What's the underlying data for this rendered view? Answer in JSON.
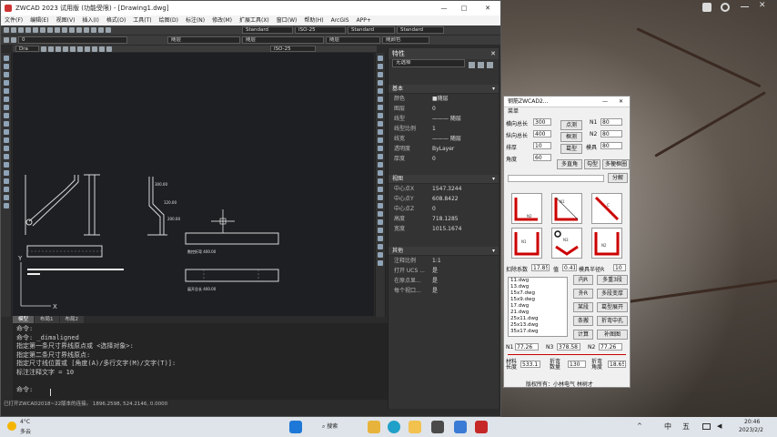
{
  "app": {
    "title": "ZWCAD 2023 试用版 (功能受限) - [Drawing1.dwg]"
  },
  "menu": [
    "文件(F)",
    "编辑(E)",
    "视图(V)",
    "插入(I)",
    "格式(O)",
    "工具(T)",
    "绘图(D)",
    "标注(N)",
    "修改(M)",
    "扩展工具(X)",
    "窗口(W)",
    "帮助(H)",
    "ArcGIS",
    "APP+"
  ],
  "toolbar": {
    "style1": "Standard",
    "dim": "ISO-25",
    "style2": "Standard",
    "style3": "Standard",
    "layer": "0",
    "color_bylayer": "随层",
    "linetype": "随层",
    "lineweight": "随层",
    "linecolor": "随颜色",
    "draw_tab": "Dra",
    "iso_small": "ISO-25"
  },
  "drawing": {
    "label_a": "数控折弯 400.00",
    "label_b": "展开总长 400.00",
    "d1": "300.00",
    "d2": "120.00",
    "d3": "200.00",
    "axis_y": "Y",
    "axis_x": "X"
  },
  "layout_tabs": [
    "模型",
    "布局1",
    "布局2"
  ],
  "command_lines": [
    "命令:",
    "命令: _dimaligned",
    "指定第一条尺寸界线原点或 <选择对象>:",
    "指定第二条尺寸界线原点:",
    "指定尺寸线位置或 [角度(A)/多行文字(M)/文字(T)]:",
    "标注注释文字 = 10",
    "",
    "命令:"
  ],
  "status_text": "已打开ZWCAD2018~22版本的连接。 1896.2598, 524.2146, 0.0000",
  "properties": {
    "title": "特性",
    "selection": "无选择",
    "basic": {
      "header": "基本",
      "rows": [
        [
          "颜色",
          "■随层"
        ],
        [
          "图层",
          "0"
        ],
        [
          "线型",
          "——— 随层"
        ],
        [
          "线型比例",
          "1"
        ],
        [
          "线宽",
          "——— 随层"
        ],
        [
          "透明度",
          "ByLayer"
        ],
        [
          "厚度",
          "0"
        ]
      ]
    },
    "view": {
      "header": "视图",
      "rows": [
        [
          "中心点X",
          "1547.3244"
        ],
        [
          "中心点Y",
          "608.8422"
        ],
        [
          "中心点Z",
          "0"
        ],
        [
          "高度",
          "718.1285"
        ],
        [
          "宽度",
          "1015.1674"
        ]
      ]
    },
    "misc": {
      "header": "其他",
      "rows": [
        [
          "注释比例",
          "1:1"
        ],
        [
          "打开 UCS ...",
          "是"
        ],
        [
          "在原点显...",
          "是"
        ],
        [
          "每个视口...",
          "是"
        ]
      ]
    }
  },
  "dialog": {
    "title": "钢筋ZWCAD2...",
    "menu": "菜单",
    "f1_label": "横向总长",
    "f1": "300",
    "f2_label": "纵向总长",
    "f2": "400",
    "f3_label": "排厚",
    "f3": "10",
    "f4_label": "角度",
    "f4": "60",
    "n1_label": "N1",
    "n1": "80",
    "n2_label": "N2",
    "n2": "80",
    "mold_label": "模具",
    "mold": "80",
    "btn_pointcalc": "点测",
    "btn_rebar": "框测",
    "btn_shape": "葛型",
    "btn_multi": "多直角",
    "btn_hook": "勾型",
    "btn_multihook": "多梗框圈",
    "btn_split": "分解",
    "coef_label": "扣除系数",
    "coef": "17.85",
    "val_label": "值",
    "val": "0.41",
    "radius_label": "模具半径R",
    "radius": "10",
    "files": [
      "11.dwg",
      "13.dwg",
      "15x7.dwg",
      "15x9.dwg",
      "17.dwg",
      "21.dwg",
      "25x11.dwg",
      "25x13.dwg",
      "35x17.dwg"
    ],
    "btn_inner": "内R",
    "btn_multi_pts": "多重3段",
    "btn_outer": "外R",
    "btn_multi_change": "多段变厚",
    "btn_stack": "某段",
    "btn_shape2": "葛型展开",
    "btn_bend": "条搬",
    "btn_flange": "折弯中孔",
    "btn_calc": "计算",
    "btn_fill": "补图图",
    "n1b_label": "N1",
    "n1b": "77.26",
    "n3_label": "N3",
    "n3": "378.58",
    "n2b_label": "N2",
    "n2b": "77.26",
    "len_label": "材料长度",
    "len": "533.1",
    "dist_label": "折弯数量",
    "dist": "130",
    "angle2_label": "折弯角度",
    "angle2": "18.65",
    "footer": "版权所有：小林电气 林树才"
  },
  "taskbar": {
    "weather_temp": "4°C",
    "weather_desc": "多云",
    "search": "搜索",
    "ime1": "中",
    "ime2": "五",
    "time": "20:46",
    "date": "2023/2/2"
  }
}
